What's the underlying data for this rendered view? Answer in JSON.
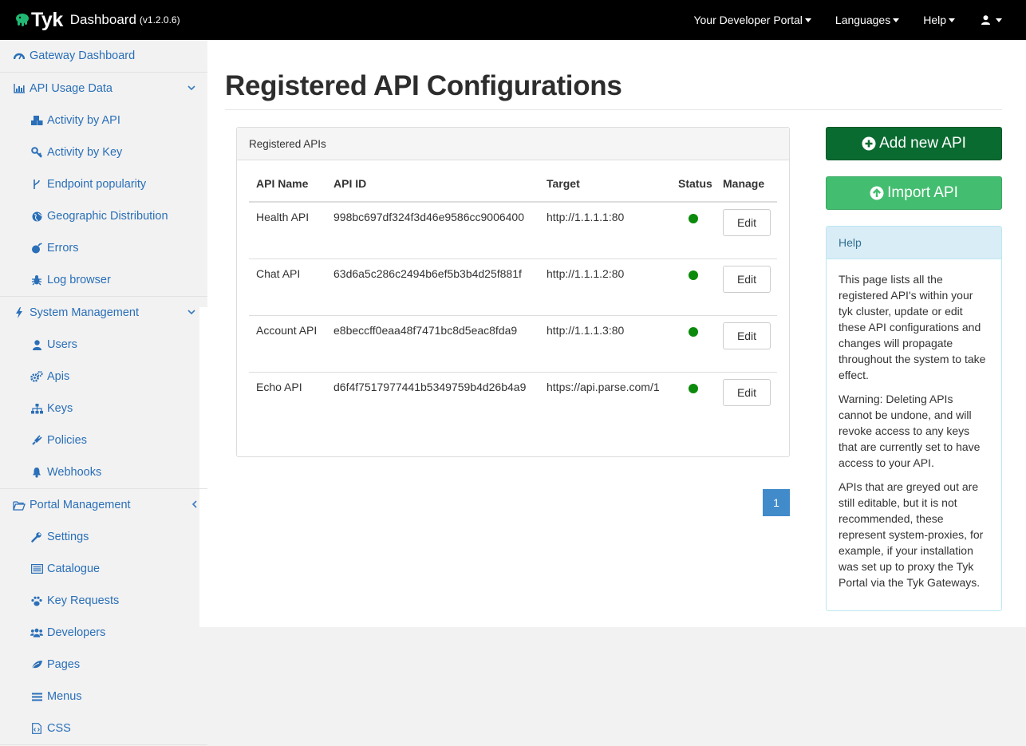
{
  "navbar": {
    "brand": "Tyk",
    "product": "Dashboard",
    "version": "(v1.2.0.6)",
    "items": [
      {
        "label": "Your Developer Portal"
      },
      {
        "label": "Languages"
      },
      {
        "label": "Help"
      }
    ],
    "user_icon": "user-icon"
  },
  "sidebar": {
    "items": [
      {
        "label": "Gateway Dashboard",
        "icon": "dashboard-icon"
      },
      {
        "label": "API Usage Data",
        "icon": "bar-chart-icon",
        "expanded": true
      },
      {
        "label": "Activity by API",
        "icon": "cubes-icon"
      },
      {
        "label": "Activity by Key",
        "icon": "key-icon"
      },
      {
        "label": "Endpoint popularity",
        "icon": "fork-icon"
      },
      {
        "label": "Geographic Distribution",
        "icon": "globe-icon"
      },
      {
        "label": "Errors",
        "icon": "bomb-icon"
      },
      {
        "label": "Log browser",
        "icon": "bug-icon"
      },
      {
        "label": "System Management",
        "icon": "bolt-icon",
        "expanded": true
      },
      {
        "label": "Users",
        "icon": "user-icon"
      },
      {
        "label": "Apis",
        "icon": "cogs-icon"
      },
      {
        "label": "Keys",
        "icon": "sitemap-icon"
      },
      {
        "label": "Policies",
        "icon": "plug-icon"
      },
      {
        "label": "Webhooks",
        "icon": "bell-icon"
      },
      {
        "label": "Portal Management",
        "icon": "folder-open-icon",
        "expanded": false
      },
      {
        "label": "Settings",
        "icon": "wrench-icon"
      },
      {
        "label": "Catalogue",
        "icon": "list-alt-icon"
      },
      {
        "label": "Key Requests",
        "icon": "paw-icon"
      },
      {
        "label": "Developers",
        "icon": "users-icon"
      },
      {
        "label": "Pages",
        "icon": "leaf-icon"
      },
      {
        "label": "Menus",
        "icon": "bars-icon"
      },
      {
        "label": "CSS",
        "icon": "file-code-icon"
      }
    ]
  },
  "main": {
    "title": "Registered API Configurations",
    "panel_title": "Registered APIs",
    "columns": [
      "API Name",
      "API ID",
      "Target",
      "Status",
      "Manage"
    ],
    "rows": [
      {
        "name": "Health API",
        "id": "998bc697df324f3d46e9586cc9006400",
        "target": "http://1.1.1.1:80",
        "status": "active",
        "action": "Edit"
      },
      {
        "name": "Chat API",
        "id": "63d6a5c286c2494b6ef5b3b4d25f881f",
        "target": "http://1.1.1.2:80",
        "status": "active",
        "action": "Edit"
      },
      {
        "name": "Account API",
        "id": "e8beccff0eaa48f7471bc8d5eac8fda9",
        "target": "http://1.1.1.3:80",
        "status": "active",
        "action": "Edit"
      },
      {
        "name": "Echo API",
        "id": "d6f4f7517977441b5349759b4d26b4a9",
        "target": "https://api.parse.com/1",
        "status": "active",
        "action": "Edit"
      }
    ],
    "pagination": {
      "current": "1"
    },
    "status_color": "#0b8a0b"
  },
  "actions": {
    "add_label": "Add new API",
    "import_label": "Import API"
  },
  "help": {
    "title": "Help",
    "paragraphs": [
      "This page lists all the registered API's within your tyk cluster, update or edit these API configurations and changes will propagate throughout the system to take effect.",
      "Warning: Deleting APIs cannot be undone, and will revoke access to any keys that are currently set to have access to your API.",
      "APIs that are greyed out are still editable, but it is not recommended, these represent system-proxies, for example, if your installation was set up to proxy the Tyk Portal via the Tyk Gateways."
    ]
  },
  "colors": {
    "navbar": "#000000",
    "link": "#2a6fb8",
    "add_button": "#0a6b30",
    "import_button": "#43bd6f",
    "pager": "#428bca",
    "help_heading": "#d9edf7"
  }
}
